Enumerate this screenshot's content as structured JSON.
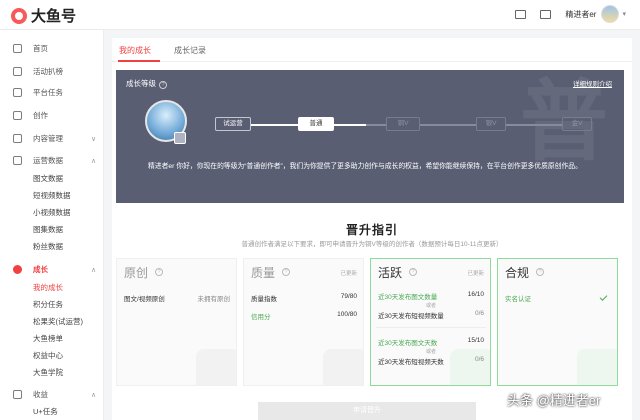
{
  "app": {
    "logo_text": "大鱼号",
    "username": "精进者er"
  },
  "sidebar": {
    "items": [
      {
        "label": "首页",
        "icon": "home-icon"
      },
      {
        "label": "活动扒榜",
        "icon": "activity-icon"
      },
      {
        "label": "平台任务",
        "icon": "bookmark-icon"
      },
      {
        "label": "创作",
        "icon": "pen-icon"
      },
      {
        "label": "内容管理",
        "icon": "folder-icon"
      },
      {
        "label": "运营数据",
        "icon": "bar-chart-icon"
      },
      {
        "label": "成长",
        "icon": "user-icon"
      },
      {
        "label": "收益",
        "icon": "coin-icon"
      }
    ],
    "sub_data": [
      "图文数据",
      "短视频数据",
      "小视频数据",
      "图集数据",
      "粉丝数据"
    ],
    "sub_growth": [
      "我的成长",
      "积分任务",
      "松果奖(试运营)",
      "大鱼榜单",
      "权益中心",
      "大鱼学院"
    ],
    "sub_income": [
      "U+任务"
    ]
  },
  "tabs": [
    "我的成长",
    "成长记录"
  ],
  "banner": {
    "title": "成长等级",
    "link": "详细规则介绍",
    "levels": [
      "试运营",
      "普通",
      "铜V",
      "银V",
      "金V"
    ],
    "watermark": "普",
    "message": "精进者er 你好，你现在的等级为“普通创作者”，我们为你提供了更多助力创作与成长的权益，希望你能继续保持，在平台创作更多优质原创作品。"
  },
  "guide": {
    "title": "晋升指引",
    "subtitle": "普通创作者满足以下要求，即可申请晋升为铜V等级的创作者（数据预计每日10-11点更新）"
  },
  "cards": [
    {
      "name": "原创",
      "rows": [
        {
          "label": "图文/视频原创",
          "value": "未拥有原创"
        }
      ]
    },
    {
      "name": "质量",
      "tag": "已更新",
      "rows": [
        {
          "label": "质量指数",
          "value": "79/80"
        },
        {
          "label": "信用分",
          "value": "100/80"
        }
      ]
    },
    {
      "name": "活跃",
      "tag": "已更新",
      "or1": "或者",
      "or2": "或者",
      "rows": [
        {
          "label": "近30天发布图文数量",
          "value": "16/10"
        },
        {
          "label": "近30天发布短视频数量",
          "value": "0/6"
        },
        {
          "label": "近30天发布图文天数",
          "value": "15/10"
        },
        {
          "label": "近30天发布短视频天数",
          "value": "0/6"
        }
      ]
    },
    {
      "name": "合规",
      "rows": [
        {
          "label": "实名认证"
        }
      ]
    }
  ],
  "submit_label": "申请晋升",
  "source_watermark": "头条 @精进者er",
  "colors": {
    "accent": "#f04142",
    "success": "#4aa953",
    "banner_bg": "#5a5e73"
  }
}
